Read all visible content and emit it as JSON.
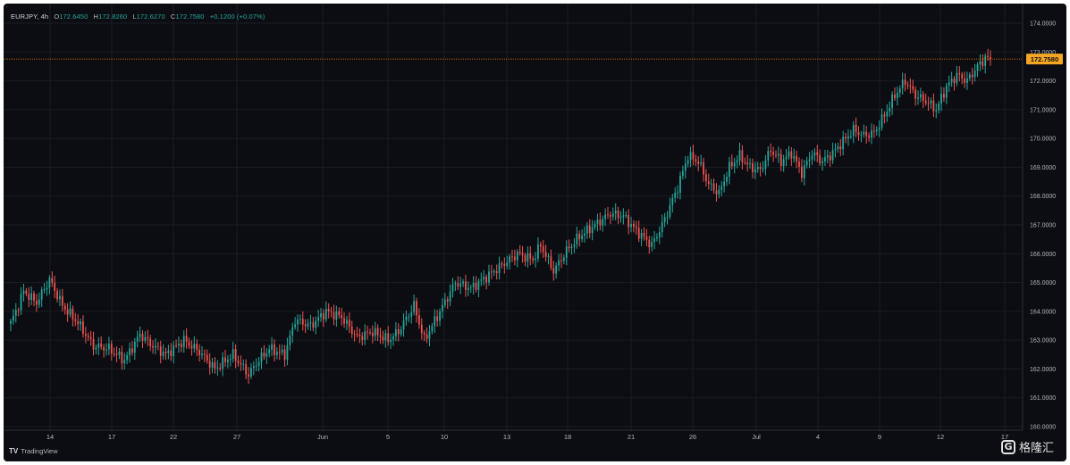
{
  "header": {
    "symbol": "EURJPY, 4h",
    "o_label": "O",
    "o_value": "172.6450",
    "h_label": "H",
    "h_value": "172.8260",
    "l_label": "L",
    "l_value": "172.6270",
    "c_label": "C",
    "c_value": "172.7580",
    "change": "+0.1200 (+0.07%)"
  },
  "footer": {
    "logo_mark": "TV",
    "logo_text": "TradingView"
  },
  "watermark": {
    "glyph": "G",
    "text": "格隆汇"
  },
  "colors": {
    "up": "#26a69a",
    "down": "#ef5350",
    "background": "#0b0d12",
    "grid": "#1a1d24",
    "price_line": "#f57c00",
    "price_label": "#f5a623"
  },
  "chart_data": {
    "type": "candlestick",
    "y_ticks": [
      "160.0000",
      "161.0000",
      "162.0000",
      "163.0000",
      "164.0000",
      "165.0000",
      "166.0000",
      "167.0000",
      "168.0000",
      "169.0000",
      "170.0000",
      "171.0000",
      "172.0000",
      "173.0000",
      "174.0000"
    ],
    "ylim": [
      159.9,
      174.2
    ],
    "x_ticks": [
      "14",
      "17",
      "22",
      "27",
      "Jun",
      "5",
      "10",
      "13",
      "18",
      "21",
      "26",
      "Jul",
      "4",
      "9",
      "12",
      "17"
    ],
    "current_price": "172.7580",
    "anchors": [
      [
        0,
        163.6
      ],
      [
        2,
        164.0
      ],
      [
        5,
        164.7
      ],
      [
        10,
        164.3
      ],
      [
        15,
        165.1
      ],
      [
        20,
        164.2
      ],
      [
        26,
        163.6
      ],
      [
        32,
        162.8
      ],
      [
        38,
        162.7
      ],
      [
        44,
        162.3
      ],
      [
        50,
        163.2
      ],
      [
        55,
        162.8
      ],
      [
        60,
        162.5
      ],
      [
        67,
        163.0
      ],
      [
        73,
        162.6
      ],
      [
        79,
        162.0
      ],
      [
        86,
        162.5
      ],
      [
        92,
        161.8
      ],
      [
        95,
        162.2
      ],
      [
        100,
        162.7
      ],
      [
        106,
        162.5
      ],
      [
        110,
        163.7
      ],
      [
        116,
        163.5
      ],
      [
        122,
        164.0
      ],
      [
        128,
        163.8
      ],
      [
        134,
        163.1
      ],
      [
        140,
        163.3
      ],
      [
        146,
        163.0
      ],
      [
        150,
        163.3
      ],
      [
        156,
        164.2
      ],
      [
        160,
        163.0
      ],
      [
        166,
        164.0
      ],
      [
        172,
        165.0
      ],
      [
        178,
        164.8
      ],
      [
        184,
        165.2
      ],
      [
        190,
        165.6
      ],
      [
        196,
        166.0
      ],
      [
        202,
        165.8
      ],
      [
        205,
        166.3
      ],
      [
        210,
        165.4
      ],
      [
        215,
        166.1
      ],
      [
        220,
        166.6
      ],
      [
        226,
        167.0
      ],
      [
        232,
        167.4
      ],
      [
        237,
        167.3
      ],
      [
        242,
        166.8
      ],
      [
        248,
        166.3
      ],
      [
        252,
        167.0
      ],
      [
        258,
        168.3
      ],
      [
        262,
        169.4
      ],
      [
        266,
        169.2
      ],
      [
        270,
        168.4
      ],
      [
        274,
        168.1
      ],
      [
        278,
        169.0
      ],
      [
        282,
        169.4
      ],
      [
        286,
        169.0
      ],
      [
        290,
        168.9
      ],
      [
        294,
        169.6
      ],
      [
        298,
        169.2
      ],
      [
        302,
        169.5
      ],
      [
        306,
        168.8
      ],
      [
        310,
        169.5
      ],
      [
        314,
        169.2
      ],
      [
        318,
        169.5
      ],
      [
        322,
        169.9
      ],
      [
        326,
        170.3
      ],
      [
        330,
        170.1
      ],
      [
        334,
        170.2
      ],
      [
        338,
        170.8
      ],
      [
        342,
        171.5
      ],
      [
        346,
        172.0
      ],
      [
        350,
        171.5
      ],
      [
        354,
        171.3
      ],
      [
        358,
        171.0
      ],
      [
        362,
        171.8
      ],
      [
        366,
        172.2
      ],
      [
        370,
        172.0
      ],
      [
        374,
        172.5
      ],
      [
        377,
        172.8
      ],
      [
        379,
        172.76
      ]
    ]
  }
}
